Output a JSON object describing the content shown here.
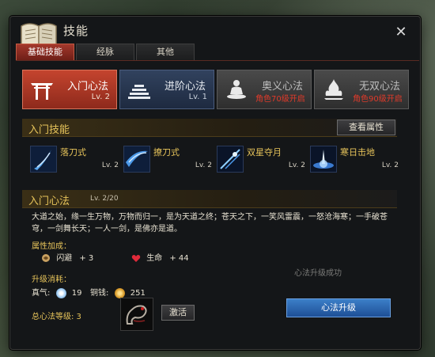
{
  "window": {
    "title": "技能",
    "close_label": "✕"
  },
  "tabs": [
    {
      "label": "基础技能",
      "active": true
    },
    {
      "label": "经脉",
      "active": false
    },
    {
      "label": "其他",
      "active": false
    }
  ],
  "categories": [
    {
      "name": "入门心法",
      "level": "Lv. 2",
      "icon": "gate-icon",
      "color": "#b33a28"
    },
    {
      "name": "进阶心法",
      "level": "Lv. 1",
      "icon": "steps-icon",
      "color": "#2a3a56"
    },
    {
      "name": "奥义心法",
      "lock_text": "角色70级开启",
      "icon": "meditation-icon"
    },
    {
      "name": "无双心法",
      "lock_text": "角色90级开启",
      "icon": "flame-icon"
    }
  ],
  "skills_section": {
    "title": "入门技能",
    "attr_button": "查看属性"
  },
  "skills": [
    {
      "name": "落刀式",
      "level": "Lv. 2",
      "icon": "blade-slash-icon"
    },
    {
      "name": "撩刀式",
      "level": "Lv. 2",
      "icon": "rising-slash-icon"
    },
    {
      "name": "双星夺月",
      "level": "Lv. 2",
      "icon": "twin-star-icon"
    },
    {
      "name": "寒日击地",
      "level": "Lv. 2",
      "icon": "ground-strike-icon"
    }
  ],
  "heart_section": {
    "title": "入门心法",
    "level": "Lv. 2/20",
    "description": "大道之始，缘一生万物，万物而归一，是为天道之终；苍天之下，一笑风雷震，一怒沧海寒；一手破苍穹，一剑舞长天；一人一剑，是佛亦是道。",
    "attr_title": "属性加成：",
    "attrs": [
      {
        "name": "闪避",
        "value": "+ 3",
        "icon": "dodge-icon"
      },
      {
        "name": "生命",
        "value": "+ 44",
        "icon": "heart-icon"
      }
    ],
    "ghost_text": "心法升级成功",
    "cost_title": "升级消耗：",
    "costs": [
      {
        "label": "真气:",
        "value": "19",
        "icon": "qi-icon"
      },
      {
        "label": "铜钱:",
        "value": "251",
        "icon": "coin-icon"
      }
    ],
    "upgrade_button": "心法升级",
    "total_label": "总心法等级: 3",
    "activate_button": "激活"
  }
}
